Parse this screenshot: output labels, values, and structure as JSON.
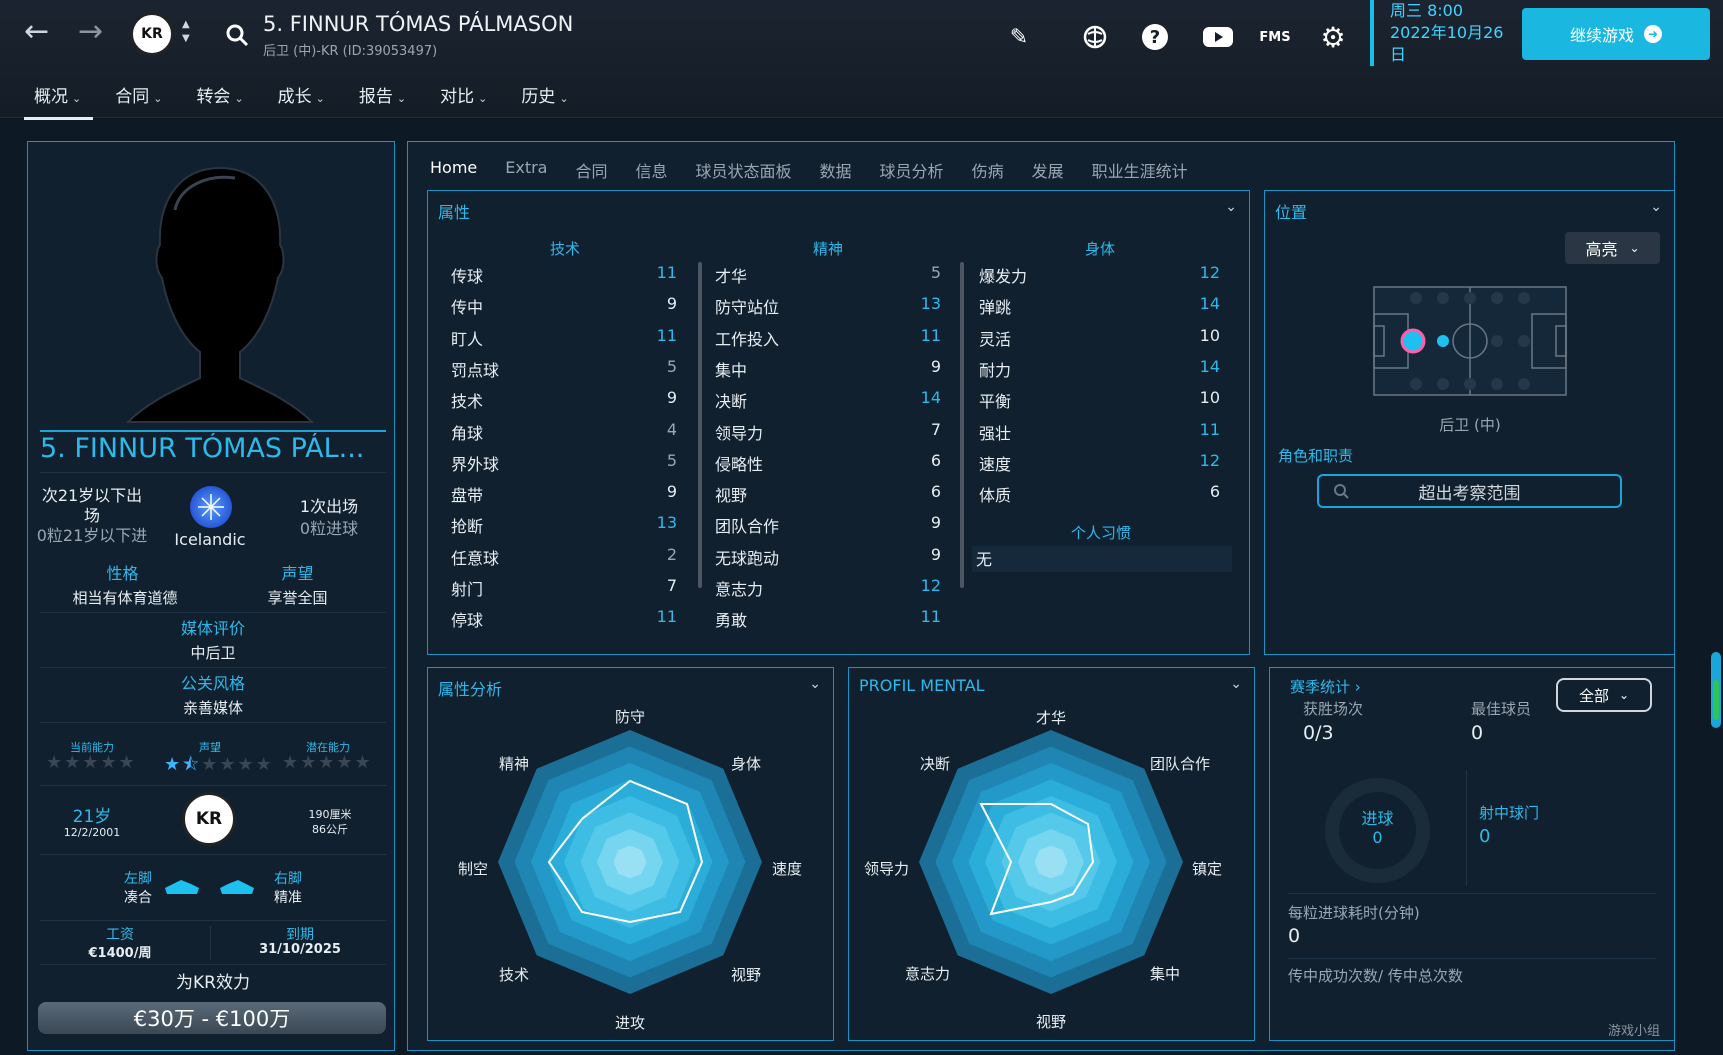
{
  "topbar": {
    "back_glyph": "←",
    "forward_glyph": "→",
    "club_badge": "KR",
    "player_title": "5. FINNUR TÓMAS PÁLMASON",
    "player_subtitle": "后卫 (中)-KR (ID:39053497)",
    "icons": [
      "search-icon",
      "pencil-icon",
      "globe-icon",
      "help-icon",
      "youtube-icon",
      "fms-icon",
      "gear-icon"
    ],
    "fms_label": "FMS",
    "date_line1": "周三 8:00",
    "date_line2": "2022年10月26",
    "date_line3": "日",
    "continue_label": "继续游戏",
    "menu": [
      {
        "label": "概况",
        "active": true
      },
      {
        "label": "合同"
      },
      {
        "label": "转会"
      },
      {
        "label": "成长"
      },
      {
        "label": "报告"
      },
      {
        "label": "对比"
      },
      {
        "label": "历史"
      }
    ]
  },
  "profile": {
    "name": "5. FINNUR TÓMAS PÁL...",
    "u21_line1": "次21岁以下出",
    "u21_line2": "场",
    "u21_goals": "0粒21岁以下进",
    "nation": "Icelandic",
    "apps": "1次出场",
    "goals": "0粒进球",
    "personality_label": "性格",
    "personality": "相当有体育道德",
    "reputation_label": "声望",
    "reputation": "享誉全国",
    "media_label": "媒体评价",
    "media": "中后卫",
    "pr_label": "公关风格",
    "pr": "亲善媒体",
    "ca_label": "当前能力",
    "rep_label": "声望",
    "pa_label": "潜在能力",
    "ca_stars": 0,
    "rep_stars": 1.5,
    "pa_stars": 0,
    "age": "21岁",
    "dob": "12/2/2001",
    "height": "190厘米",
    "weight": "86公斤",
    "left_foot_label": "左脚",
    "left_foot": "凑合",
    "right_foot_label": "右脚",
    "right_foot": "精准",
    "wage_label": "工资",
    "wage": "€1400/周",
    "expiry_label": "到期",
    "expiry": "31/10/2025",
    "plays_for": "为KR效力",
    "value": "€30万 - €100万"
  },
  "tabs": [
    "Home",
    "Extra",
    "合同",
    "信息",
    "球员状态面板",
    "数据",
    "球员分析",
    "伤病",
    "发展",
    "职业生涯统计"
  ],
  "attributes": {
    "title": "属性",
    "technical_head": "技术",
    "mental_head": "精神",
    "physical_head": "身体",
    "technical": [
      {
        "name": "传球",
        "value": 11
      },
      {
        "name": "传中",
        "value": 9
      },
      {
        "name": "盯人",
        "value": 11
      },
      {
        "name": "罚点球",
        "value": 5
      },
      {
        "name": "技术",
        "value": 9
      },
      {
        "name": "角球",
        "value": 4
      },
      {
        "name": "界外球",
        "value": 5
      },
      {
        "name": "盘带",
        "value": 9
      },
      {
        "name": "抢断",
        "value": 13
      },
      {
        "name": "任意球",
        "value": 2
      },
      {
        "name": "射门",
        "value": 7
      },
      {
        "name": "停球",
        "value": 11
      }
    ],
    "mental": [
      {
        "name": "才华",
        "value": 5
      },
      {
        "name": "防守站位",
        "value": 13
      },
      {
        "name": "工作投入",
        "value": 11
      },
      {
        "name": "集中",
        "value": 9
      },
      {
        "name": "决断",
        "value": 14
      },
      {
        "name": "领导力",
        "value": 7
      },
      {
        "name": "侵略性",
        "value": 6
      },
      {
        "name": "视野",
        "value": 6
      },
      {
        "name": "团队合作",
        "value": 9
      },
      {
        "name": "无球跑动",
        "value": 9
      },
      {
        "name": "意志力",
        "value": 12
      },
      {
        "name": "勇敢",
        "value": 11
      }
    ],
    "physical": [
      {
        "name": "爆发力",
        "value": 12
      },
      {
        "name": "弹跳",
        "value": 14
      },
      {
        "name": "灵活",
        "value": 10
      },
      {
        "name": "耐力",
        "value": 14
      },
      {
        "name": "平衡",
        "value": 10
      },
      {
        "name": "强壮",
        "value": 11
      },
      {
        "name": "速度",
        "value": 12
      },
      {
        "name": "体质",
        "value": 6
      }
    ],
    "habits_head": "个人习惯",
    "habits_value": "无"
  },
  "position": {
    "title": "位置",
    "highlight_label": "高亮",
    "position_name": "后卫 (中)",
    "roles_label": "角色和职责",
    "roles_search": "超出考察范围"
  },
  "analysis": {
    "title": "属性分析",
    "labels": [
      "防守",
      "身体",
      "速度",
      "视野",
      "进攻",
      "技术",
      "制空",
      "精神"
    ]
  },
  "mental_profile": {
    "title": "PROFIL MENTAL",
    "labels": [
      "才华",
      "团队合作",
      "镇定",
      "集中",
      "视野",
      "意志力",
      "领导力",
      "决断"
    ]
  },
  "season": {
    "title": "赛季统计",
    "filter": "全部",
    "wins_label": "获胜场次",
    "wins": "0/3",
    "best_label": "最佳球员",
    "best": "0",
    "goals_label": "进球",
    "goals": "0",
    "shots_label": "射中球门",
    "shots": "0",
    "mins_label": "每粒进球耗时(分钟)",
    "mins": "0",
    "cross_label": "传中成功次数/ 传中总次数"
  },
  "watermark": "游戏小组"
}
